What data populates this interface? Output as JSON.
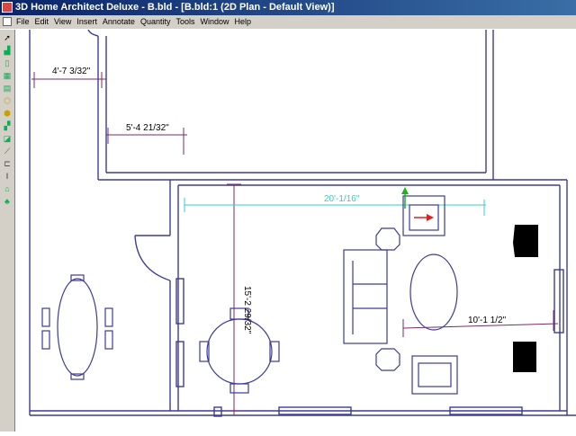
{
  "window": {
    "title": "3D Home Architect Deluxe - B.bld - [B.bld:1 (2D Plan - Default View)]"
  },
  "menu": {
    "items": [
      "File",
      "Edit",
      "View",
      "Insert",
      "Annotate",
      "Quantity",
      "Tools",
      "Window",
      "Help"
    ]
  },
  "toolbar": {
    "icons": [
      "select-arrow-icon",
      "wall-icon",
      "door-icon",
      "window-icon",
      "cabinet-icon",
      "room-icon",
      "roof-icon",
      "stairs-icon",
      "terrain-icon",
      "dimension-icon",
      "text-icon",
      "column-icon",
      "furniture-icon",
      "plant-icon"
    ]
  },
  "plan": {
    "dimensions": {
      "top_left": "4'-7 3/32\"",
      "middle_left": "5'-4 21/32\"",
      "cyan": "20'-1/16\"",
      "vertical": "15'-2 29/32\"",
      "right": "10'-1 1/2\""
    },
    "colors": {
      "wall": "#3b3b9a",
      "dim": "#7b2a6a",
      "cyan": "#33cccc",
      "red": "#e02020",
      "green": "#20b020"
    }
  }
}
